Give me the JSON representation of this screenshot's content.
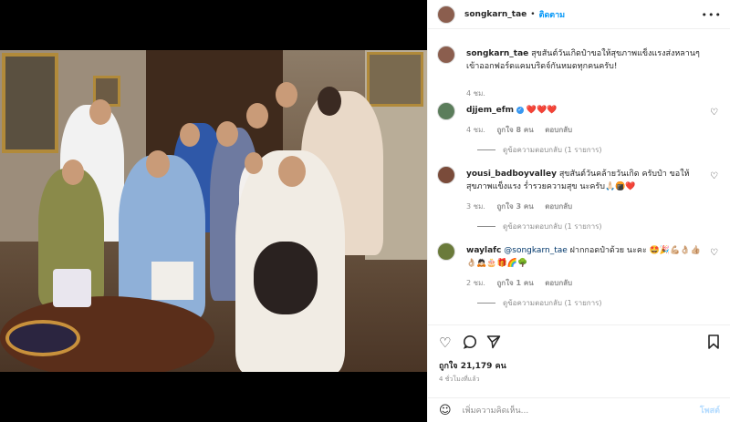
{
  "header": {
    "username": "songkarn_tae",
    "separator": "•",
    "follow_label": "ติดตาม",
    "more_icon": "more-horizontal-icon"
  },
  "caption": {
    "username": "songkarn_tae",
    "text": "สุขสันต์วันเกิดป๋าขอให้สุขภาพแข็งแรงส่งหลานๆเข้าออกฟอร์ดแคมบริดจ์กันหมดทุกคนครับ!",
    "time": "4 ชม."
  },
  "comments": [
    {
      "username": "djjem_efm",
      "verified": true,
      "text": "❤️❤️❤️",
      "time": "4 ชม.",
      "likes": "ถูกใจ 8 คน",
      "reply_label": "ตอบกลับ",
      "view_replies": "ดูข้อความตอบกลับ (1 รายการ)"
    },
    {
      "username": "yousi_badboyvalley",
      "verified": false,
      "text": "สุขสันต์วันคล้ายวันเกิด ครับป๋า ขอให้สุขภาพแข็งแรง ร่ำรวยความสุข นะครับ🙏🏻🍘❤️",
      "time": "3 ชม.",
      "likes": "ถูกใจ 3 คน",
      "reply_label": "ตอบกลับ",
      "view_replies": "ดูข้อความตอบกลับ (1 รายการ)"
    },
    {
      "username": "waylafc",
      "verified": false,
      "mention": "@songkarn_tae",
      "text": "ฝากกอดป๋าด้วย นะคะ 🤩🎉💪🏼👌🏼👍🏼👌🏼🙇🏻🎂🎁🌈🌳",
      "time": "2 ชม.",
      "likes": "ถูกใจ 1 คน",
      "reply_label": "ตอบกลับ",
      "view_replies": "ดูข้อความตอบกลับ (1 รายการ)"
    }
  ],
  "actions": {
    "like_icon": "heart-icon",
    "comment_icon": "comment-icon",
    "share_icon": "share-icon",
    "save_icon": "bookmark-icon",
    "likes_text": "ถูกใจ 21,179 คน",
    "time_text": "4 ชั่วโมงที่แล้ว"
  },
  "add_comment": {
    "emoji_icon": "smiley-icon",
    "placeholder": "เพิ่มความคิดเห็น...",
    "post_label": "โพสต์"
  }
}
